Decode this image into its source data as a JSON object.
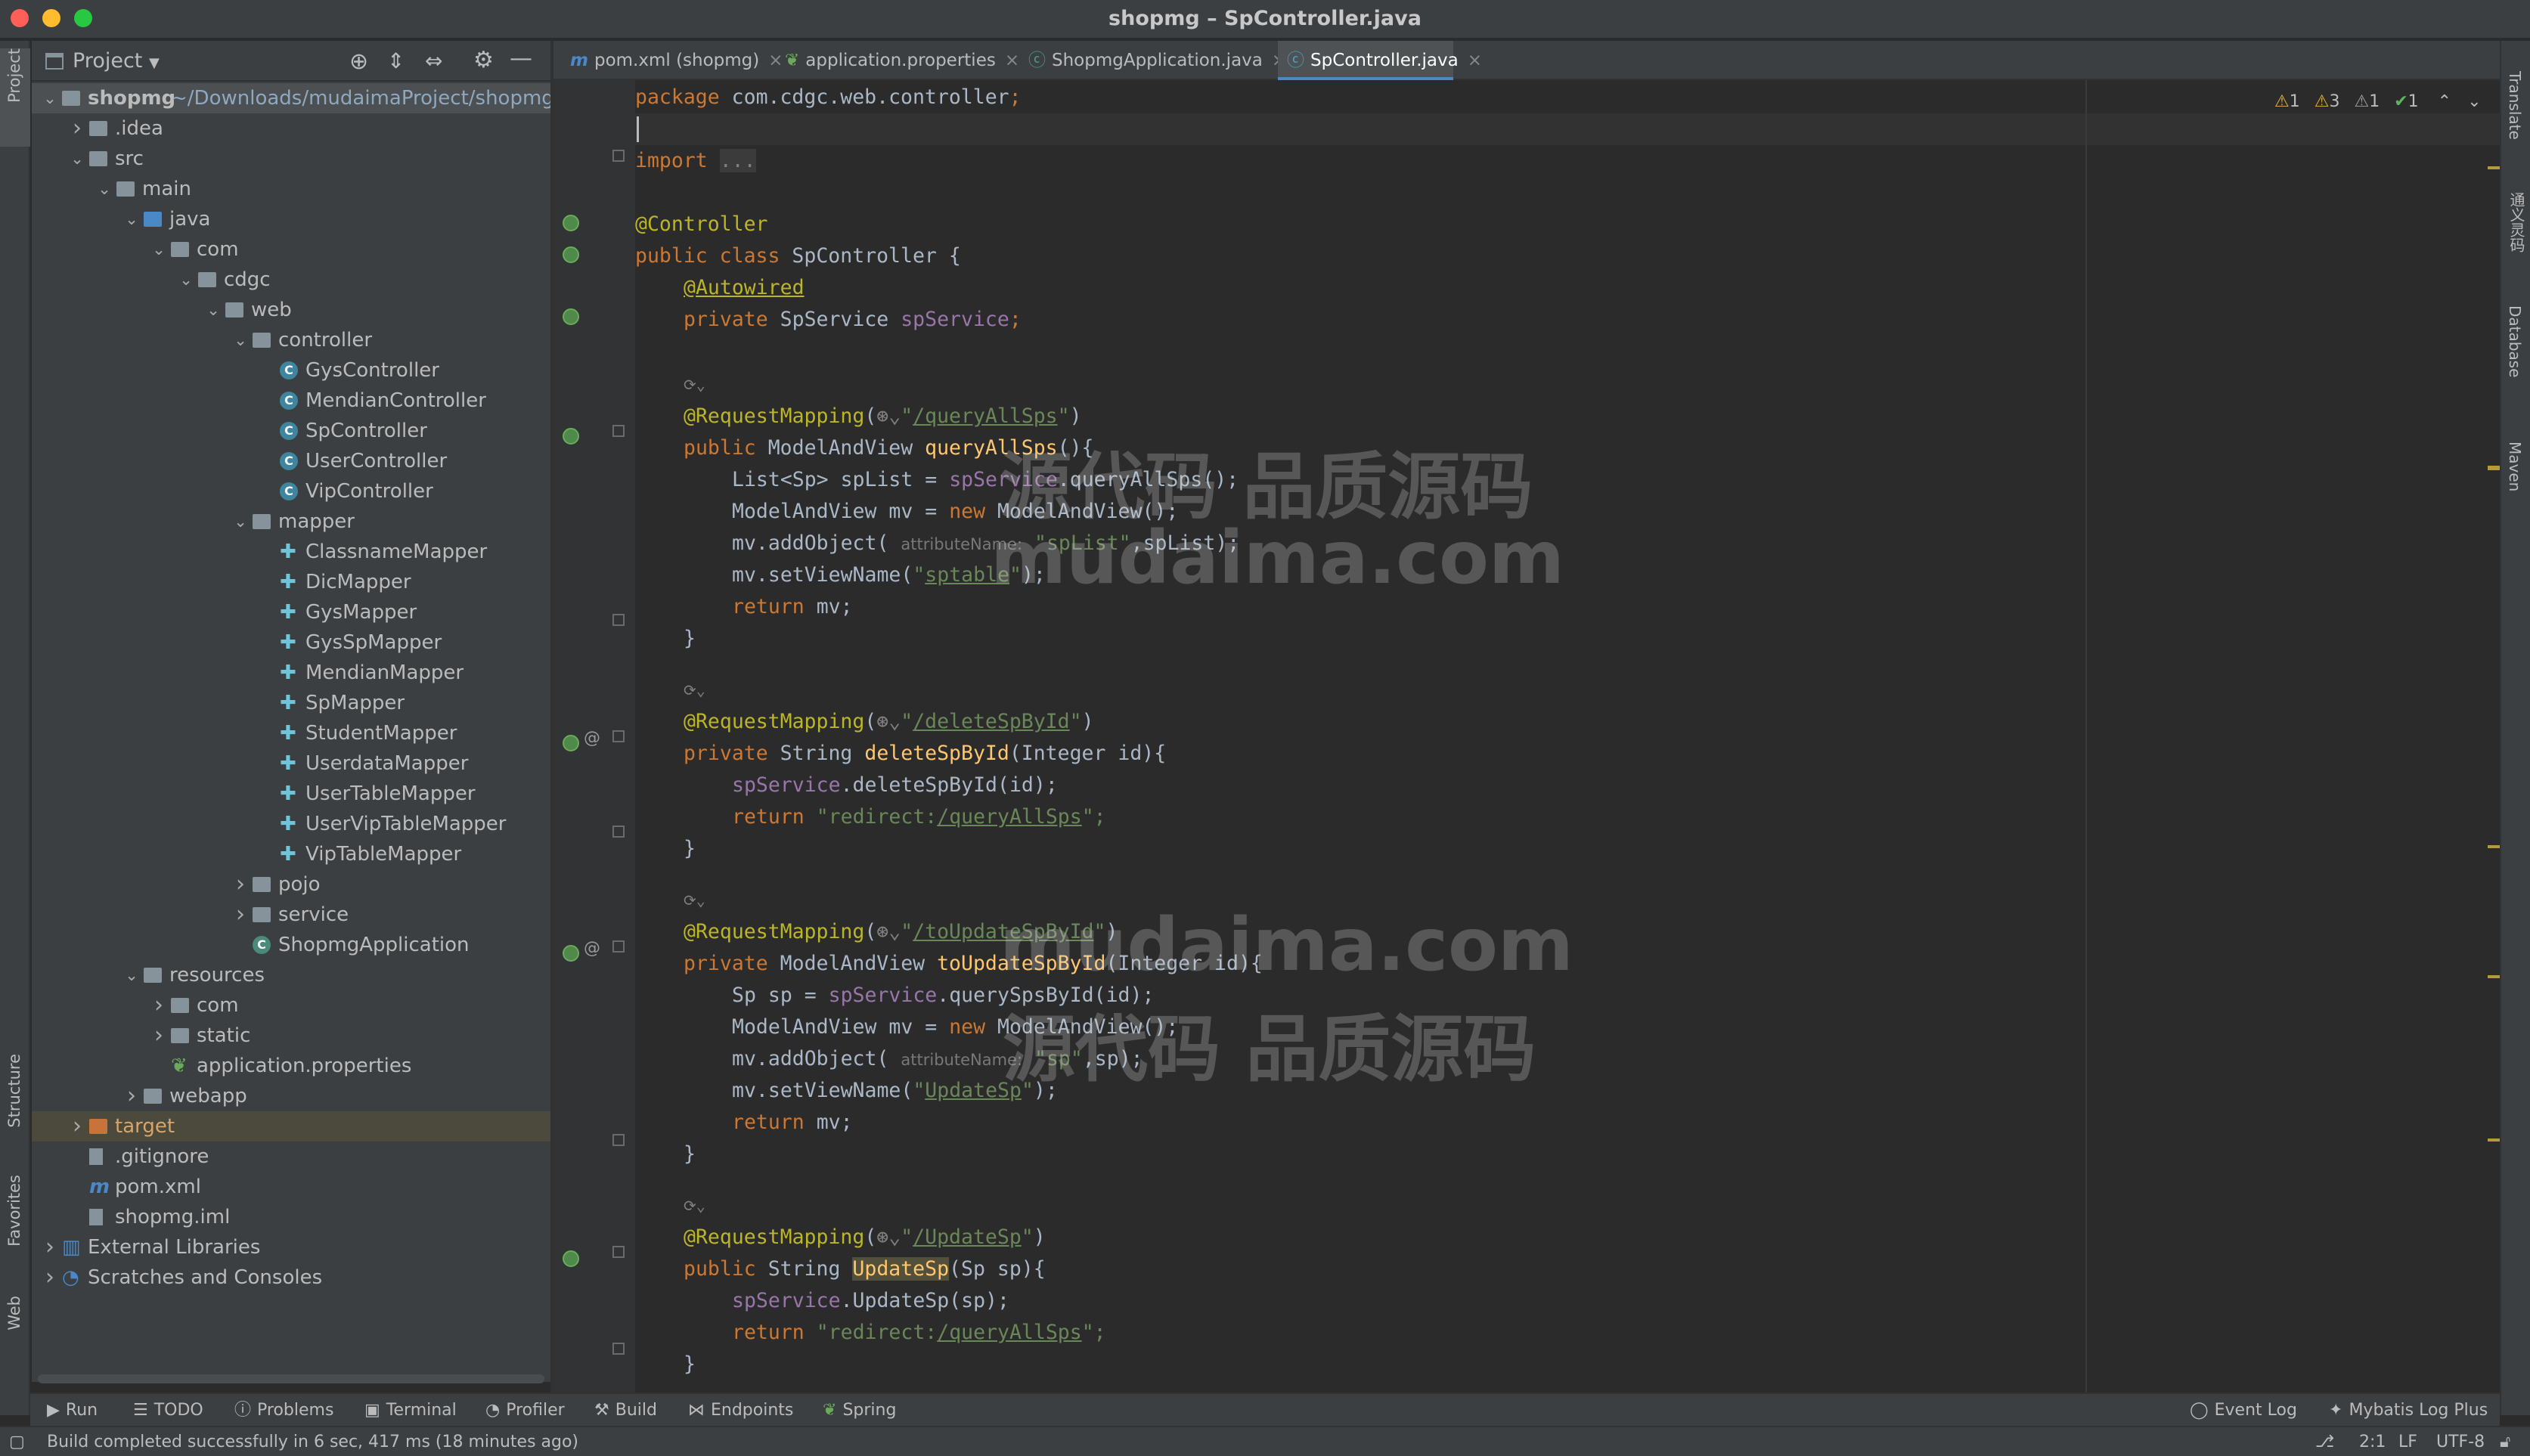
{
  "window": {
    "title": "shopmg – SpController.java"
  },
  "left_strip": {
    "project": "Project",
    "structure": "Structure",
    "favorites": "Favorites",
    "web": "Web"
  },
  "right_strip": {
    "translate": "Translate",
    "tongyi": "通义灵码",
    "database": "Database",
    "maven": "Maven"
  },
  "project_panel": {
    "title": "Project"
  },
  "tree": [
    {
      "label": "shopmg",
      "sub": "~/Downloads/mudaimaProject/shopmg",
      "icon": "module-folder-icon",
      "depth": 0,
      "arrow": "down",
      "selected": true,
      "bold": true
    },
    {
      "label": ".idea",
      "icon": "folder-icon",
      "depth": 1,
      "arrow": "right"
    },
    {
      "label": "src",
      "icon": "folder-icon",
      "depth": 1,
      "arrow": "down"
    },
    {
      "label": "main",
      "icon": "folder-icon",
      "depth": 2,
      "arrow": "down"
    },
    {
      "label": "java",
      "icon": "source-folder-icon",
      "depth": 3,
      "arrow": "down"
    },
    {
      "label": "com",
      "icon": "package-icon",
      "depth": 4,
      "arrow": "down"
    },
    {
      "label": "cdgc",
      "icon": "package-icon",
      "depth": 5,
      "arrow": "down"
    },
    {
      "label": "web",
      "icon": "package-icon",
      "depth": 6,
      "arrow": "down"
    },
    {
      "label": "controller",
      "icon": "package-icon",
      "depth": 7,
      "arrow": "down"
    },
    {
      "label": "GysController",
      "icon": "class-icon",
      "depth": 8
    },
    {
      "label": "MendianController",
      "icon": "class-icon",
      "depth": 8
    },
    {
      "label": "SpController",
      "icon": "class-icon",
      "depth": 8
    },
    {
      "label": "UserController",
      "icon": "class-icon",
      "depth": 8
    },
    {
      "label": "VipController",
      "icon": "class-icon",
      "depth": 8
    },
    {
      "label": "mapper",
      "icon": "package-icon",
      "depth": 7,
      "arrow": "down"
    },
    {
      "label": "ClassnameMapper",
      "icon": "mybatis-icon",
      "depth": 8
    },
    {
      "label": "DicMapper",
      "icon": "mybatis-icon",
      "depth": 8
    },
    {
      "label": "GysMapper",
      "icon": "mybatis-icon",
      "depth": 8
    },
    {
      "label": "GysSpMapper",
      "icon": "mybatis-icon",
      "depth": 8
    },
    {
      "label": "MendianMapper",
      "icon": "mybatis-icon",
      "depth": 8
    },
    {
      "label": "SpMapper",
      "icon": "mybatis-icon",
      "depth": 8
    },
    {
      "label": "StudentMapper",
      "icon": "mybatis-icon",
      "depth": 8
    },
    {
      "label": "UserdataMapper",
      "icon": "mybatis-icon",
      "depth": 8
    },
    {
      "label": "UserTableMapper",
      "icon": "mybatis-icon",
      "depth": 8
    },
    {
      "label": "UserVipTableMapper",
      "icon": "mybatis-icon",
      "depth": 8
    },
    {
      "label": "VipTableMapper",
      "icon": "mybatis-icon",
      "depth": 8
    },
    {
      "label": "pojo",
      "icon": "package-icon",
      "depth": 7,
      "arrow": "right"
    },
    {
      "label": "service",
      "icon": "package-icon",
      "depth": 7,
      "arrow": "right"
    },
    {
      "label": "ShopmgApplication",
      "icon": "spring-boot-class-icon",
      "depth": 7
    },
    {
      "label": "resources",
      "icon": "resources-folder-icon",
      "depth": 3,
      "arrow": "down"
    },
    {
      "label": "com",
      "icon": "folder-icon",
      "depth": 4,
      "arrow": "right"
    },
    {
      "label": "static",
      "icon": "folder-icon",
      "depth": 4,
      "arrow": "right"
    },
    {
      "label": "application.properties",
      "icon": "properties-file-icon",
      "depth": 4
    },
    {
      "label": "webapp",
      "icon": "folder-icon",
      "depth": 3,
      "arrow": "right"
    },
    {
      "label": "target",
      "icon": "excluded-folder-icon",
      "depth": 1,
      "arrow": "right",
      "highlight": true
    },
    {
      "label": ".gitignore",
      "icon": "gitignore-file-icon",
      "depth": 1
    },
    {
      "label": "pom.xml",
      "icon": "maven-file-icon",
      "depth": 1
    },
    {
      "label": "shopmg.iml",
      "icon": "iml-file-icon",
      "depth": 1
    },
    {
      "label": "External Libraries",
      "icon": "libraries-icon",
      "depth": 0,
      "arrow": "right"
    },
    {
      "label": "Scratches and Consoles",
      "icon": "scratches-icon",
      "depth": 0,
      "arrow": "right"
    }
  ],
  "editor_tabs": [
    {
      "label": "pom.xml (shopmg)",
      "icon": "maven-file-icon",
      "active": false
    },
    {
      "label": "application.properties",
      "icon": "properties-file-icon",
      "active": false
    },
    {
      "label": "ShopmgApplication.java",
      "icon": "spring-boot-class-icon",
      "active": false
    },
    {
      "label": "SpController.java",
      "icon": "class-icon",
      "active": true
    }
  ],
  "inspections": {
    "warn1": "1",
    "warn2": "3",
    "weak": "1",
    "ok": "1"
  },
  "code": {
    "package_kw": "package",
    "package_name": "com.cdgc.web.controller",
    "import_kw": "import",
    "import_folded": "...",
    "anno_controller": "@Controller",
    "class_decl": "public class",
    "class_name": "SpController",
    "anno_autowired": "@Autowired",
    "private_kw": "private",
    "public_kw": "public",
    "return_kw": "return",
    "new_kw": "new",
    "sp_service_type": "SpService",
    "sp_service_field": "spService",
    "request_mapping": "@RequestMapping",
    "hint_attr": "attributeName:",
    "m1": {
      "path": "/queryAllSps",
      "ret": "ModelAndView",
      "name": "queryAllSps",
      "params": "()",
      "l1": "List<Sp> spList = ",
      "l1b": ".queryAllSps();",
      "l2": "ModelAndView mv = ",
      "l2b": " ModelAndView();",
      "l3": "mv.addObject(",
      "l3s": "\"spList\"",
      "l3b": ",spList);",
      "l4": "mv.setViewName(",
      "l4s": "sptable",
      "l5": " mv;"
    },
    "m2": {
      "path": "/deleteSpById",
      "ret": "String",
      "name": "deleteSpById",
      "params": "(Integer id){",
      "l1b": ".deleteSpById(id);",
      "l2s": "\"redirect:",
      "l2p": "/queryAllSps",
      "l2e": "\";"
    },
    "m3": {
      "path": "/toUpdateSpById",
      "ret": "ModelAndView",
      "name": "toUpdateSpById",
      "params": "(Integer id){",
      "l1": "Sp sp = ",
      "l1b": ".querySpsById(id);",
      "l2": "ModelAndView mv = ",
      "l2b": " ModelAndView();",
      "l3": "mv.addObject(",
      "l3s": "\"sp\"",
      "l3b": ",sp);",
      "l4": "mv.setViewName(",
      "l4s": "UpdateSp",
      "l5": " mv;"
    },
    "m4": {
      "path": "/UpdateSp",
      "ret": "String",
      "name": "UpdateSp",
      "params": "(Sp sp){",
      "l1b": ".UpdateSp(sp);",
      "l2s": "\"redirect:",
      "l2p": "/queryAllSps",
      "l2e": "\";"
    }
  },
  "watermarks": {
    "a": "源代码 品质源码",
    "b": "mudaima.com",
    "c": "mudaima.com",
    "d": "源代码 品质源码"
  },
  "bottom_toolbar": {
    "run": "Run",
    "todo": "TODO",
    "problems": "Problems",
    "terminal": "Terminal",
    "profiler": "Profiler",
    "build": "Build",
    "endpoints": "Endpoints",
    "spring": "Spring",
    "event_log": "Event Log",
    "mybatis": "Mybatis Log Plus"
  },
  "status": {
    "message": "Build completed successfully in 6 sec, 417 ms (18 minutes ago)",
    "position": "2:1",
    "line_sep": "LF",
    "encoding": "UTF-8"
  }
}
